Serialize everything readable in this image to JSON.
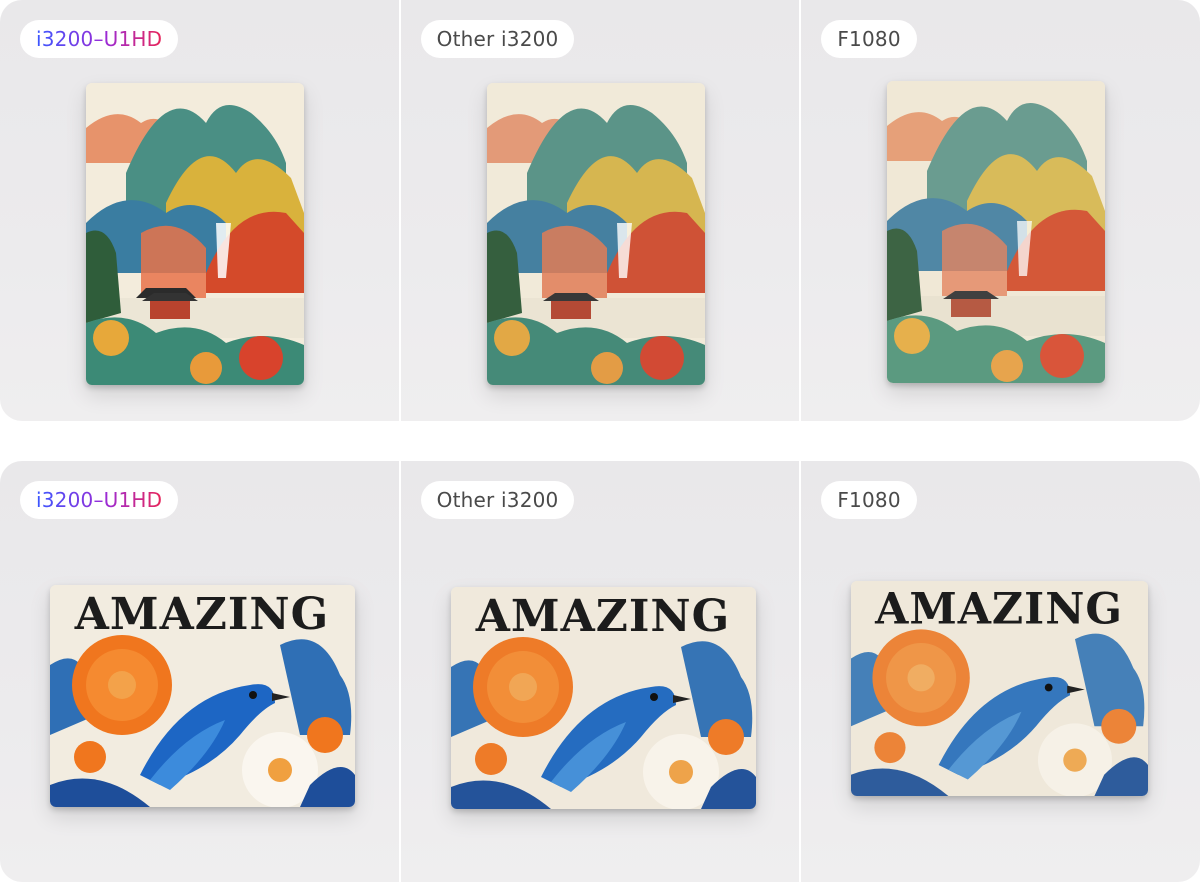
{
  "rows": [
    {
      "id": "landscape-painting",
      "cells": [
        {
          "label": "i3200–U1HD",
          "highlight": true
        },
        {
          "label": "Other i3200",
          "highlight": false
        },
        {
          "label": "F1080",
          "highlight": false
        }
      ]
    },
    {
      "id": "bird-flower",
      "headline": "AMAZING",
      "cells": [
        {
          "label": "i3200–U1HD",
          "highlight": true
        },
        {
          "label": "Other i3200",
          "highlight": false
        },
        {
          "label": "F1080",
          "highlight": false
        }
      ]
    }
  ],
  "colors": {
    "badge_gradient_start": "#3b58ff",
    "badge_gradient_end": "#e8265a",
    "panel_background": "#ebeaec",
    "tile_background": "#f4efe4"
  },
  "icons": [
    "landscape-painting-print",
    "bird-flower-print"
  ]
}
